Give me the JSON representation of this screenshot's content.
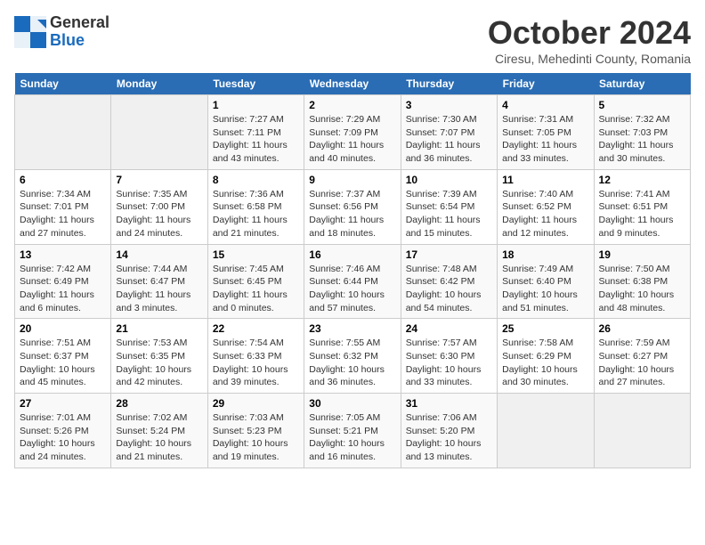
{
  "logo": {
    "part1": "General",
    "part2": "Blue"
  },
  "title": "October 2024",
  "subtitle": "Ciresu, Mehedinti County, Romania",
  "days_of_week": [
    "Sunday",
    "Monday",
    "Tuesday",
    "Wednesday",
    "Thursday",
    "Friday",
    "Saturday"
  ],
  "weeks": [
    [
      {
        "day": "",
        "info": ""
      },
      {
        "day": "",
        "info": ""
      },
      {
        "day": "1",
        "info": "Sunrise: 7:27 AM\nSunset: 7:11 PM\nDaylight: 11 hours and 43 minutes."
      },
      {
        "day": "2",
        "info": "Sunrise: 7:29 AM\nSunset: 7:09 PM\nDaylight: 11 hours and 40 minutes."
      },
      {
        "day": "3",
        "info": "Sunrise: 7:30 AM\nSunset: 7:07 PM\nDaylight: 11 hours and 36 minutes."
      },
      {
        "day": "4",
        "info": "Sunrise: 7:31 AM\nSunset: 7:05 PM\nDaylight: 11 hours and 33 minutes."
      },
      {
        "day": "5",
        "info": "Sunrise: 7:32 AM\nSunset: 7:03 PM\nDaylight: 11 hours and 30 minutes."
      }
    ],
    [
      {
        "day": "6",
        "info": "Sunrise: 7:34 AM\nSunset: 7:01 PM\nDaylight: 11 hours and 27 minutes."
      },
      {
        "day": "7",
        "info": "Sunrise: 7:35 AM\nSunset: 7:00 PM\nDaylight: 11 hours and 24 minutes."
      },
      {
        "day": "8",
        "info": "Sunrise: 7:36 AM\nSunset: 6:58 PM\nDaylight: 11 hours and 21 minutes."
      },
      {
        "day": "9",
        "info": "Sunrise: 7:37 AM\nSunset: 6:56 PM\nDaylight: 11 hours and 18 minutes."
      },
      {
        "day": "10",
        "info": "Sunrise: 7:39 AM\nSunset: 6:54 PM\nDaylight: 11 hours and 15 minutes."
      },
      {
        "day": "11",
        "info": "Sunrise: 7:40 AM\nSunset: 6:52 PM\nDaylight: 11 hours and 12 minutes."
      },
      {
        "day": "12",
        "info": "Sunrise: 7:41 AM\nSunset: 6:51 PM\nDaylight: 11 hours and 9 minutes."
      }
    ],
    [
      {
        "day": "13",
        "info": "Sunrise: 7:42 AM\nSunset: 6:49 PM\nDaylight: 11 hours and 6 minutes."
      },
      {
        "day": "14",
        "info": "Sunrise: 7:44 AM\nSunset: 6:47 PM\nDaylight: 11 hours and 3 minutes."
      },
      {
        "day": "15",
        "info": "Sunrise: 7:45 AM\nSunset: 6:45 PM\nDaylight: 11 hours and 0 minutes."
      },
      {
        "day": "16",
        "info": "Sunrise: 7:46 AM\nSunset: 6:44 PM\nDaylight: 10 hours and 57 minutes."
      },
      {
        "day": "17",
        "info": "Sunrise: 7:48 AM\nSunset: 6:42 PM\nDaylight: 10 hours and 54 minutes."
      },
      {
        "day": "18",
        "info": "Sunrise: 7:49 AM\nSunset: 6:40 PM\nDaylight: 10 hours and 51 minutes."
      },
      {
        "day": "19",
        "info": "Sunrise: 7:50 AM\nSunset: 6:38 PM\nDaylight: 10 hours and 48 minutes."
      }
    ],
    [
      {
        "day": "20",
        "info": "Sunrise: 7:51 AM\nSunset: 6:37 PM\nDaylight: 10 hours and 45 minutes."
      },
      {
        "day": "21",
        "info": "Sunrise: 7:53 AM\nSunset: 6:35 PM\nDaylight: 10 hours and 42 minutes."
      },
      {
        "day": "22",
        "info": "Sunrise: 7:54 AM\nSunset: 6:33 PM\nDaylight: 10 hours and 39 minutes."
      },
      {
        "day": "23",
        "info": "Sunrise: 7:55 AM\nSunset: 6:32 PM\nDaylight: 10 hours and 36 minutes."
      },
      {
        "day": "24",
        "info": "Sunrise: 7:57 AM\nSunset: 6:30 PM\nDaylight: 10 hours and 33 minutes."
      },
      {
        "day": "25",
        "info": "Sunrise: 7:58 AM\nSunset: 6:29 PM\nDaylight: 10 hours and 30 minutes."
      },
      {
        "day": "26",
        "info": "Sunrise: 7:59 AM\nSunset: 6:27 PM\nDaylight: 10 hours and 27 minutes."
      }
    ],
    [
      {
        "day": "27",
        "info": "Sunrise: 7:01 AM\nSunset: 5:26 PM\nDaylight: 10 hours and 24 minutes."
      },
      {
        "day": "28",
        "info": "Sunrise: 7:02 AM\nSunset: 5:24 PM\nDaylight: 10 hours and 21 minutes."
      },
      {
        "day": "29",
        "info": "Sunrise: 7:03 AM\nSunset: 5:23 PM\nDaylight: 10 hours and 19 minutes."
      },
      {
        "day": "30",
        "info": "Sunrise: 7:05 AM\nSunset: 5:21 PM\nDaylight: 10 hours and 16 minutes."
      },
      {
        "day": "31",
        "info": "Sunrise: 7:06 AM\nSunset: 5:20 PM\nDaylight: 10 hours and 13 minutes."
      },
      {
        "day": "",
        "info": ""
      },
      {
        "day": "",
        "info": ""
      }
    ]
  ]
}
